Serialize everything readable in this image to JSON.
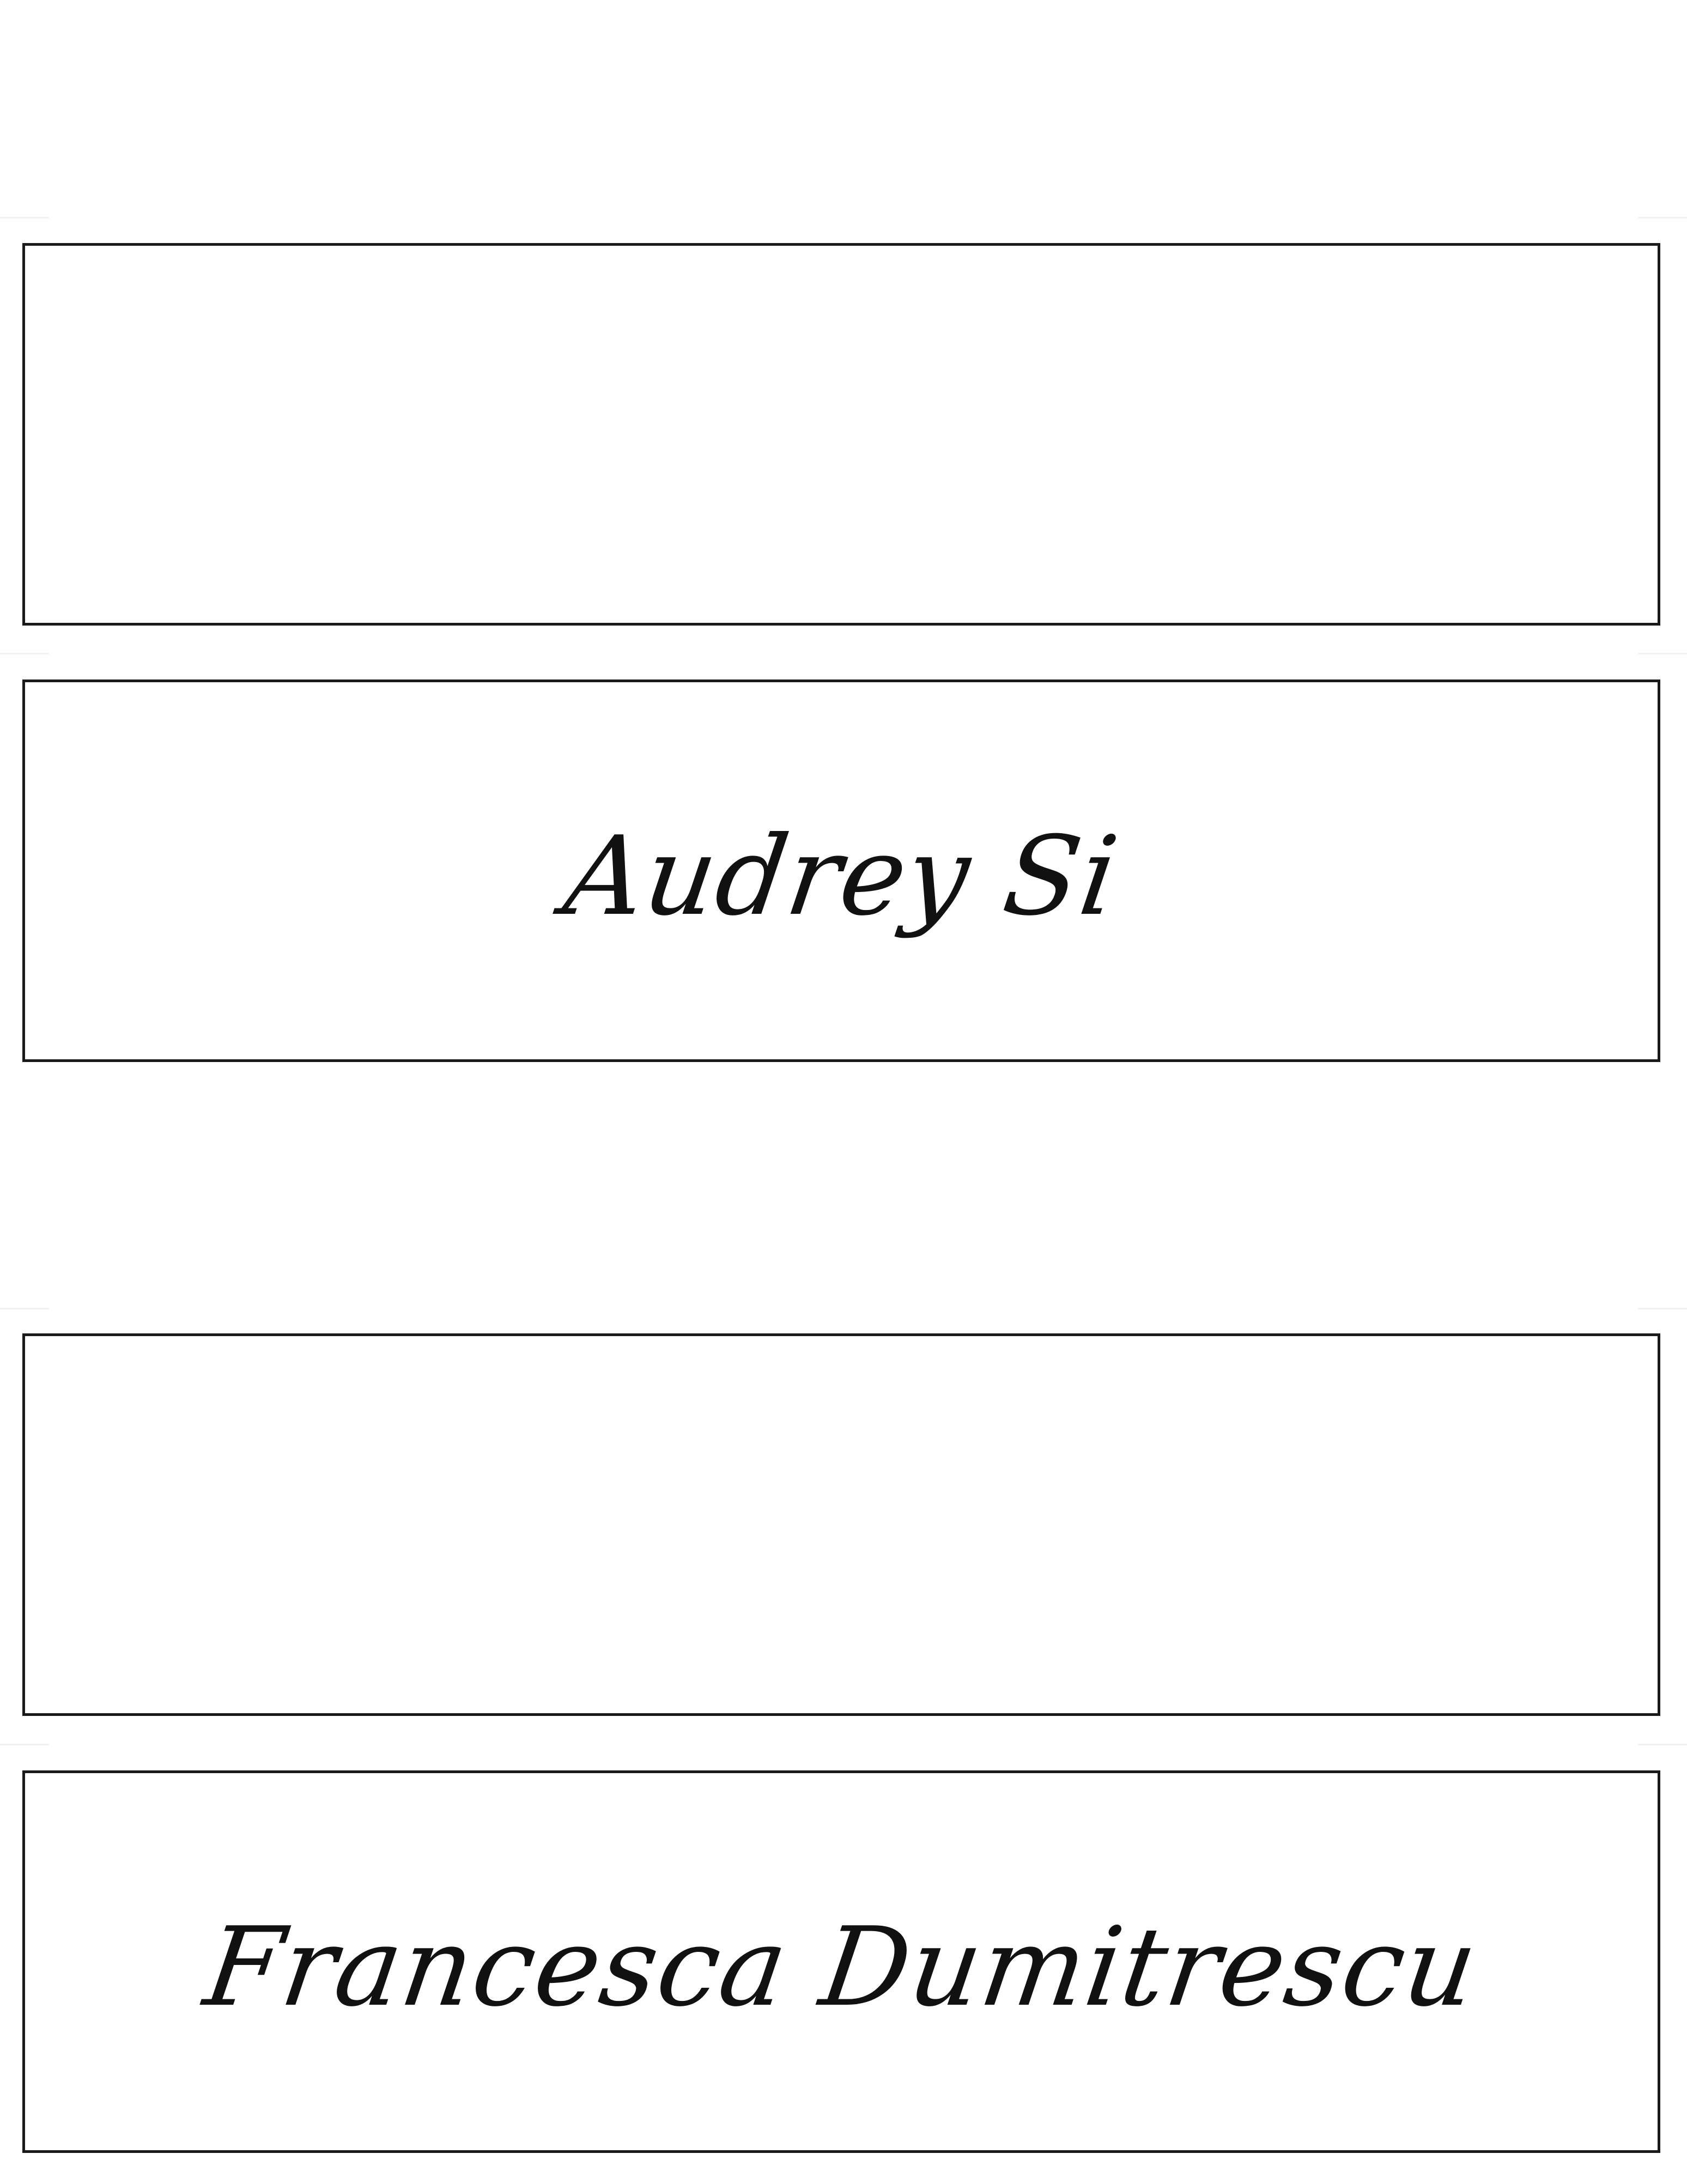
{
  "place_cards": [
    {
      "position": "top-back",
      "name": ""
    },
    {
      "position": "top-front",
      "name": "Audrey Si"
    },
    {
      "position": "bottom-back",
      "name": ""
    },
    {
      "position": "bottom-front",
      "name": "Francesca Dumitrescu"
    }
  ],
  "colors": {
    "border": "#1a1a1a",
    "text": "#111111",
    "fold_mark": "#f1f1f1",
    "background": "#ffffff"
  }
}
